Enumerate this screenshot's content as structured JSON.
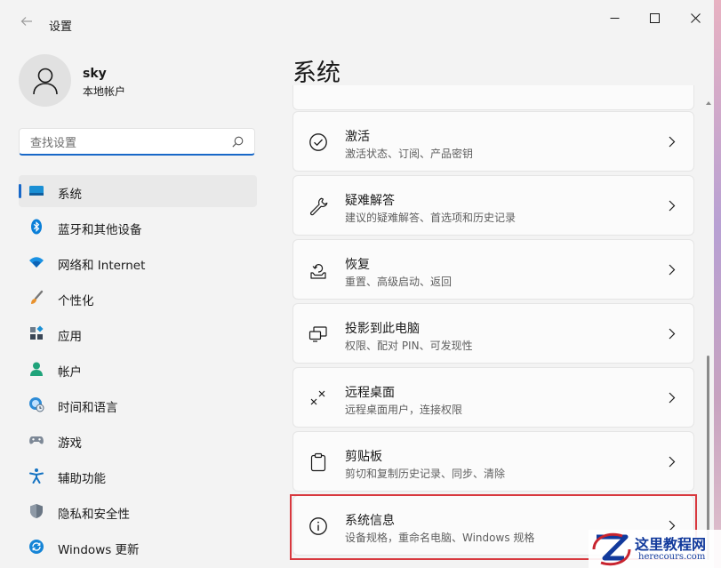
{
  "app": {
    "title": "设置"
  },
  "profile": {
    "name": "sky",
    "account_type": "本地帐户"
  },
  "search": {
    "placeholder": "查找设置"
  },
  "nav": {
    "items": [
      {
        "label": "系统",
        "icon": "system-icon"
      },
      {
        "label": "蓝牙和其他设备",
        "icon": "bluetooth-icon"
      },
      {
        "label": "网络和 Internet",
        "icon": "network-icon"
      },
      {
        "label": "个性化",
        "icon": "personalization-icon"
      },
      {
        "label": "应用",
        "icon": "apps-icon"
      },
      {
        "label": "帐户",
        "icon": "accounts-icon"
      },
      {
        "label": "时间和语言",
        "icon": "time-language-icon"
      },
      {
        "label": "游戏",
        "icon": "gaming-icon"
      },
      {
        "label": "辅助功能",
        "icon": "accessibility-icon"
      },
      {
        "label": "隐私和安全性",
        "icon": "privacy-icon"
      },
      {
        "label": "Windows 更新",
        "icon": "windows-update-icon"
      }
    ]
  },
  "page": {
    "title": "系统"
  },
  "settings": [
    {
      "title": "激活",
      "subtitle": "激活状态、订阅、产品密钥",
      "icon": "activation-icon"
    },
    {
      "title": "疑难解答",
      "subtitle": "建议的疑难解答、首选项和历史记录",
      "icon": "troubleshoot-icon"
    },
    {
      "title": "恢复",
      "subtitle": "重置、高级启动、返回",
      "icon": "recovery-icon"
    },
    {
      "title": "投影到此电脑",
      "subtitle": "权限、配对 PIN、可发现性",
      "icon": "projecting-icon"
    },
    {
      "title": "远程桌面",
      "subtitle": "远程桌面用户，连接权限",
      "icon": "remote-desktop-icon"
    },
    {
      "title": "剪贴板",
      "subtitle": "剪切和复制历史记录、同步、清除",
      "icon": "clipboard-icon"
    },
    {
      "title": "系统信息",
      "subtitle": "设备规格，重命名电脑、Windows 规格",
      "icon": "about-icon"
    }
  ],
  "watermark": {
    "name": "这里教程网",
    "url": "herecours.com"
  },
  "colors": {
    "accent": "#1868c8",
    "highlight": "#d8383e",
    "watermark": "#123a9c"
  }
}
